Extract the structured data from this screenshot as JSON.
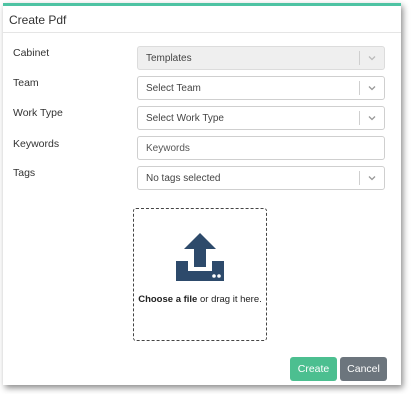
{
  "dialog": {
    "title": "Create Pdf"
  },
  "fields": {
    "cabinet": {
      "label": "Cabinet",
      "value": "Templates"
    },
    "team": {
      "label": "Team",
      "value": "Select Team"
    },
    "work_type": {
      "label": "Work Type",
      "value": "Select Work Type"
    },
    "keywords": {
      "label": "Keywords",
      "placeholder": "Keywords"
    },
    "tags": {
      "label": "Tags",
      "value": "No tags selected"
    }
  },
  "dropzone": {
    "choose_label": "Choose a file",
    "drag_label": " or drag it here.",
    "icon": "upload-icon"
  },
  "buttons": {
    "create": "Create",
    "cancel": "Cancel"
  },
  "colors": {
    "accent": "#4ec3a3",
    "create_button": "#4cbf90",
    "cancel_button": "#6c757d",
    "icon": "#2d4a6b"
  }
}
